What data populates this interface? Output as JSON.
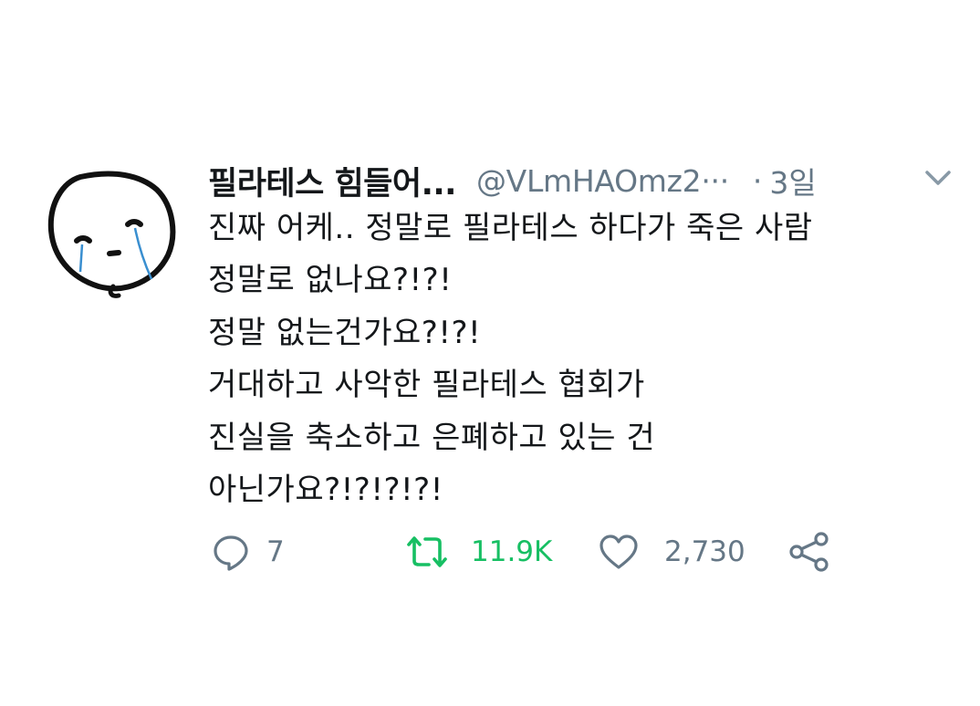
{
  "tweet": {
    "display_name": "필라테스 힘들어...",
    "handle": "@VLmHAOmz2···",
    "dot": "·",
    "time": "3일",
    "lines": [
      "진짜 어케.. 정말로 필라테스 하다가 죽은 사람",
      "정말로 없나요?!?!",
      "정말 없는건가요?!?!",
      "거대하고 사악한 필라테스 협회가",
      "진실을 축소하고 은폐하고 있는 건",
      "아닌가요?!?!?!?!"
    ],
    "actions": {
      "reply_count": "7",
      "retweet_count": "11.9K",
      "like_count": "2,730"
    },
    "icons": {
      "avatar": "crying-face-drawing",
      "caret": "chevron-down-icon",
      "reply": "comment-icon",
      "retweet": "retweet-icon",
      "like": "heart-icon",
      "share": "share-icon"
    },
    "colors": {
      "text": "#14171a",
      "secondary": "#657786",
      "retweet": "#17bf63"
    }
  }
}
